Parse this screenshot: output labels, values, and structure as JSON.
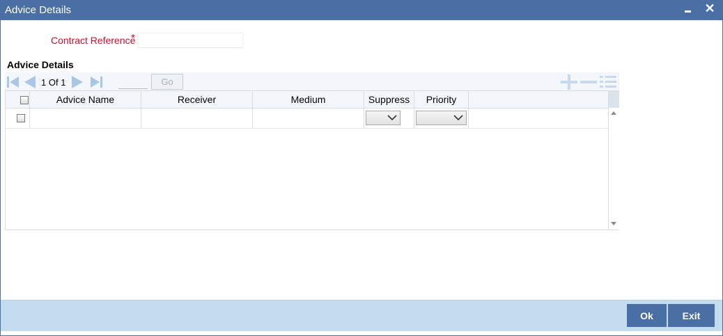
{
  "window": {
    "title": "Advice Details"
  },
  "form": {
    "contract_reference_label": "Contract Reference",
    "required_marker": "*",
    "contract_reference_value": ""
  },
  "section": {
    "title": "Advice Details"
  },
  "pager": {
    "current_page": "1",
    "of_label": "Of",
    "total_pages": "1",
    "page_input_value": "",
    "go_label": "Go"
  },
  "table": {
    "columns": [
      "",
      "Advice Name",
      "Receiver",
      "Medium",
      "Suppress",
      "Priority"
    ],
    "rows": [
      {
        "checked": false,
        "advice_name": "",
        "receiver": "",
        "medium": "",
        "suppress": "",
        "priority": ""
      }
    ]
  },
  "footer": {
    "ok_label": "Ok",
    "exit_label": "Exit"
  },
  "colors": {
    "titlebar": "#4a6fa5",
    "required_label": "#c8102e",
    "footer": "#c3dcee",
    "button": "#4a6fa5",
    "nav_icons": "#a9c6e4"
  },
  "icons": {
    "first_page": "first-page-icon",
    "prev_page": "prev-page-icon",
    "next_page": "next-page-icon",
    "last_page": "last-page-icon",
    "add_row": "plus-icon",
    "delete_row": "minus-icon",
    "single_view": "list-view-icon"
  }
}
